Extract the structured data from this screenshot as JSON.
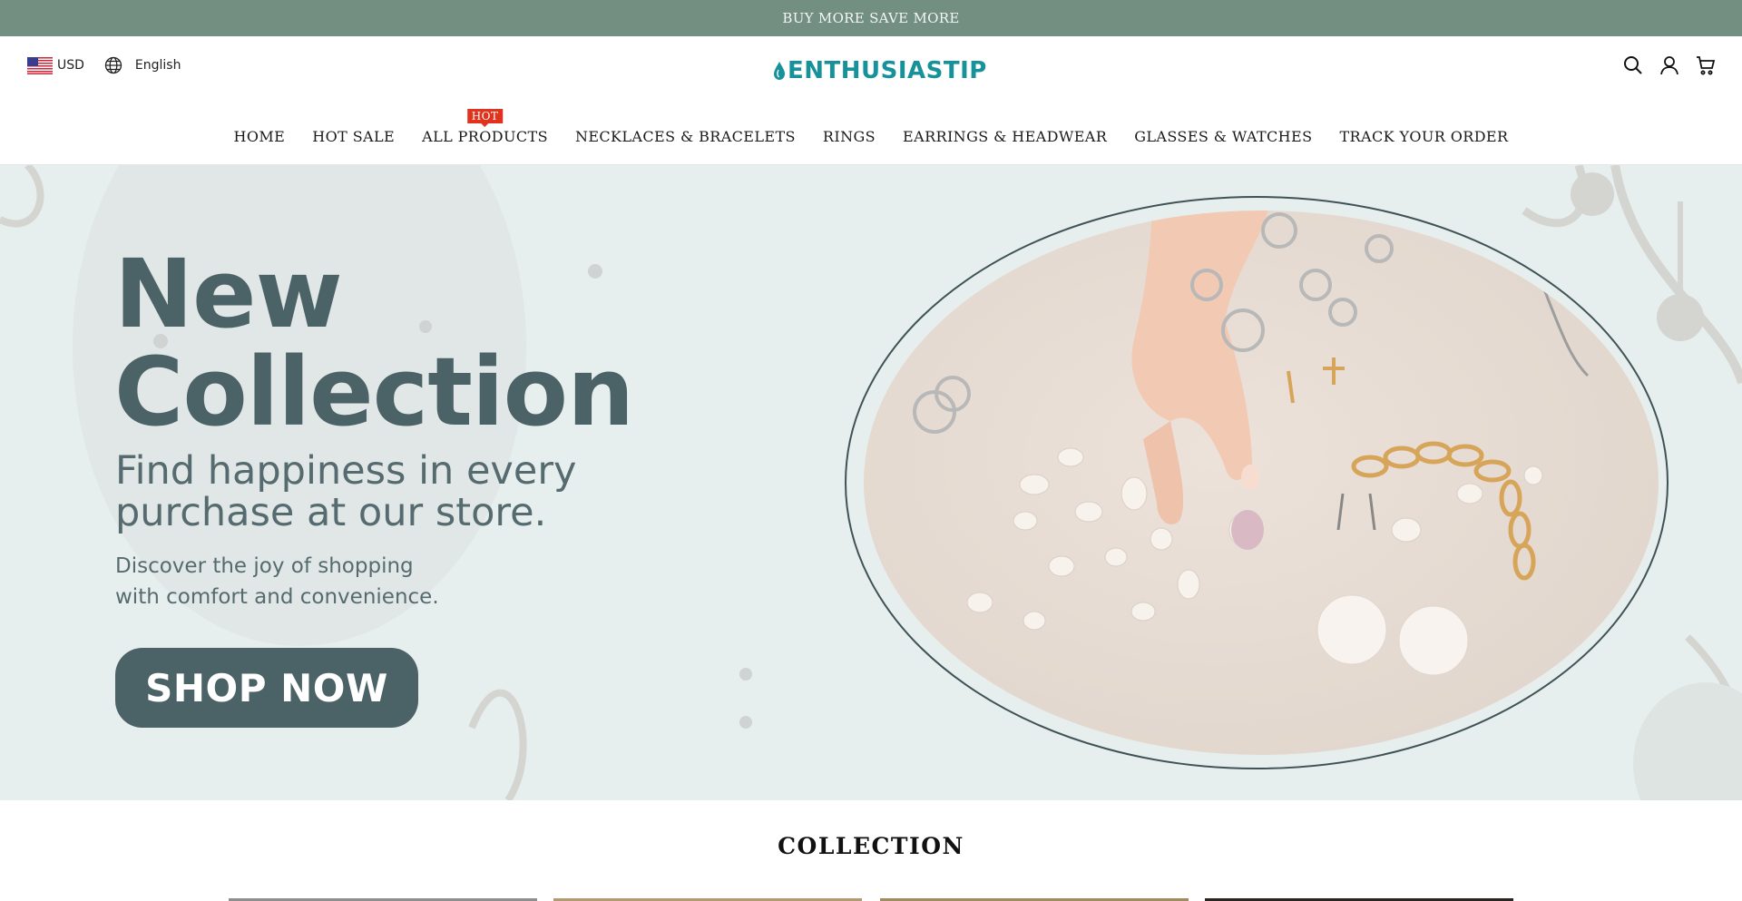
{
  "announcement": {
    "text": "BUY MORE SAVE MORE"
  },
  "header": {
    "currency": "USD",
    "language": "English",
    "logo_text": "ENTHUSIASTIP",
    "icons": [
      "search-icon",
      "account-icon",
      "cart-icon"
    ]
  },
  "nav": {
    "items": [
      {
        "label": "HOME"
      },
      {
        "label": "HOT SALE"
      },
      {
        "label": "ALL PRODUCTS",
        "badge": "HOT"
      },
      {
        "label": "NECKLACES & BRACELETS"
      },
      {
        "label": "RINGS"
      },
      {
        "label": "EARRINGS & HEADWEAR"
      },
      {
        "label": "GLASSES & WATCHES"
      },
      {
        "label": "TRACK YOUR ORDER"
      }
    ]
  },
  "hero": {
    "title_line1": "New",
    "title_line2": "Collection",
    "subtitle_line1": "Find happiness in every",
    "subtitle_line2": "purchase at our store.",
    "desc_line1": "Discover the joy of shopping",
    "desc_line2": "with comfort and convenience.",
    "button": "SHOP NOW"
  },
  "collection": {
    "title": "COLLECTION"
  },
  "colors": {
    "announcement_bg": "#728f82",
    "logo": "#17929b",
    "hero_bg": "#e7efee",
    "hero_text": "#4b6266",
    "hot_badge": "#e0321c"
  }
}
